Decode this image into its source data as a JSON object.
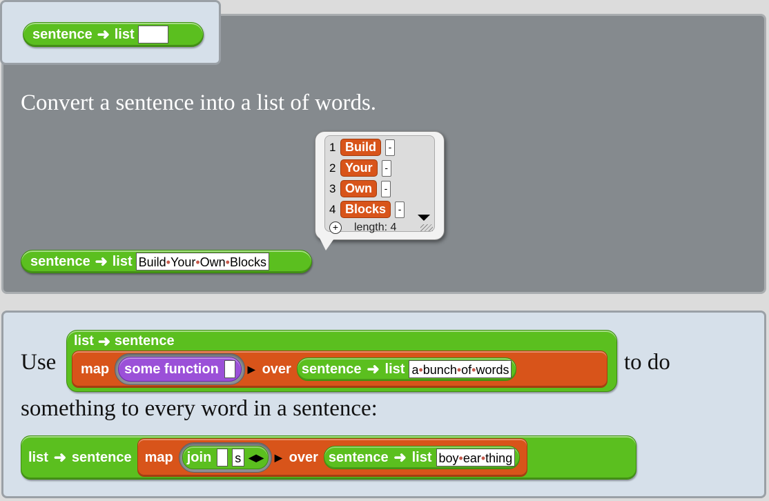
{
  "tab_block": {
    "label_left": "sentence",
    "label_right": "list",
    "slot_value": ""
  },
  "top": {
    "description": "Convert a sentence into a list of words.",
    "list_watcher": {
      "items": [
        {
          "index": "1",
          "value": "Build"
        },
        {
          "index": "2",
          "value": "Your"
        },
        {
          "index": "3",
          "value": "Own"
        },
        {
          "index": "4",
          "value": "Blocks"
        }
      ],
      "minus": "-",
      "length_text": "length: 4"
    },
    "example_block": {
      "label_left": "sentence",
      "label_right": "list",
      "slot_words": [
        "Build",
        "Your",
        "Own",
        "Blocks"
      ]
    }
  },
  "bottom": {
    "use_text": "Use",
    "to_do_text": "to do",
    "para2": "something to every word in a sentence:",
    "block1": {
      "outer_left": "list",
      "outer_right": "sentence",
      "map_label": "map",
      "function_label": "some function",
      "over_label": "over",
      "inner_left": "sentence",
      "inner_right": "list",
      "slot_words": [
        "a",
        "bunch",
        "of",
        "words"
      ]
    },
    "block2": {
      "outer_left": "list",
      "outer_right": "sentence",
      "map_label": "map",
      "join_label": "join",
      "join_slot2": "s",
      "over_label": "over",
      "inner_left": "sentence",
      "inner_right": "list",
      "slot_words": [
        "boy",
        "ear",
        "thing"
      ]
    }
  },
  "icons": {
    "arrow": "right-arrow-icon",
    "plus": "plus-circle-icon"
  }
}
